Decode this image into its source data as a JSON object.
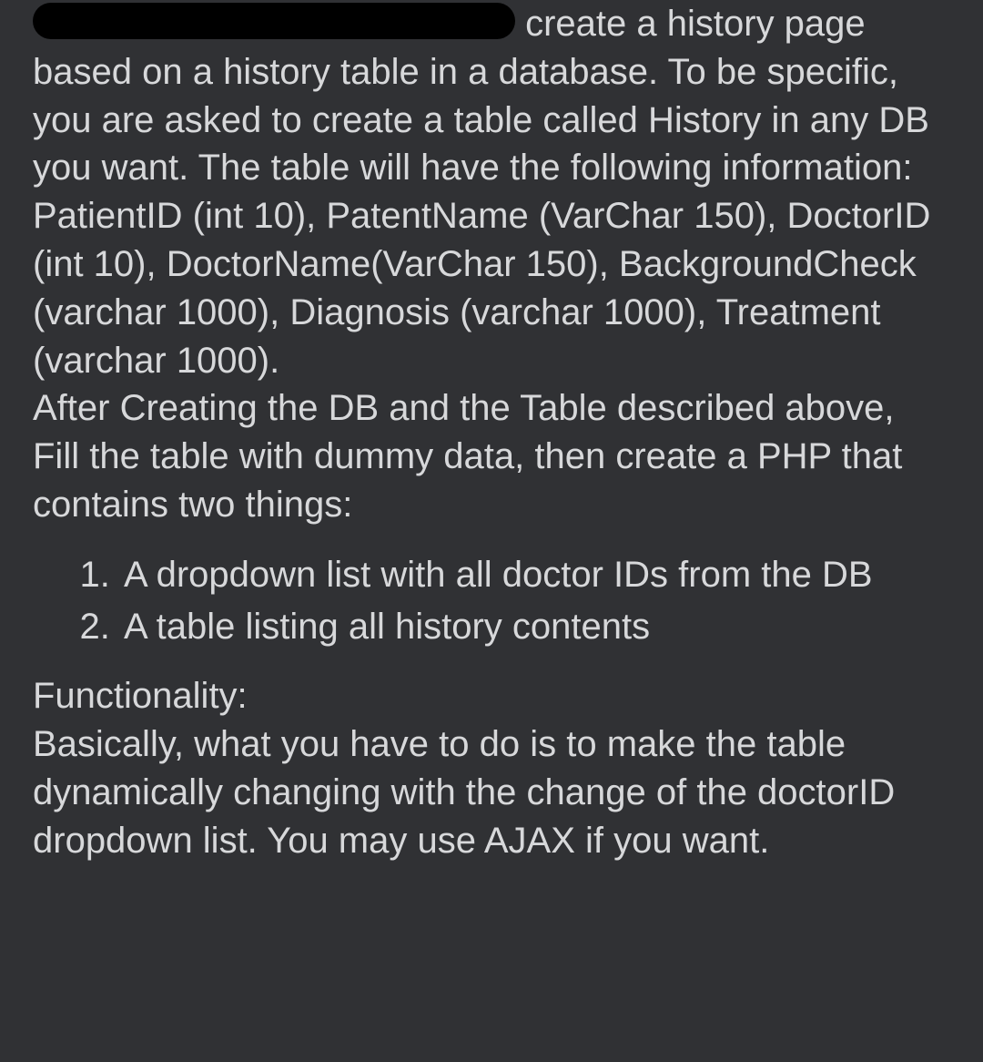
{
  "paragraph1_prefix_text": " create a history page based on a history table in a database. To be specific, you are asked to create a table called History in any DB you want. The table will have the following information: PatientID (int 10), PatentName (VarChar 150), DoctorID (int 10), DoctorName(VarChar 150), BackgroundCheck (varchar 1000), Diagnosis (varchar 1000), Treatment (varchar 1000).",
  "paragraph1_suffix_text": "After Creating the DB and the Table described above, Fill the table with dummy data, then create a PHP that contains two things:",
  "requirements": [
    "A dropdown list with all doctor IDs from the DB",
    "A table listing all history contents"
  ],
  "functionality_heading": "Functionality:",
  "functionality_body": "Basically, what you have to do is to make the table dynamically changing with the change of the doctorID dropdown list. You may use AJAX if you want."
}
